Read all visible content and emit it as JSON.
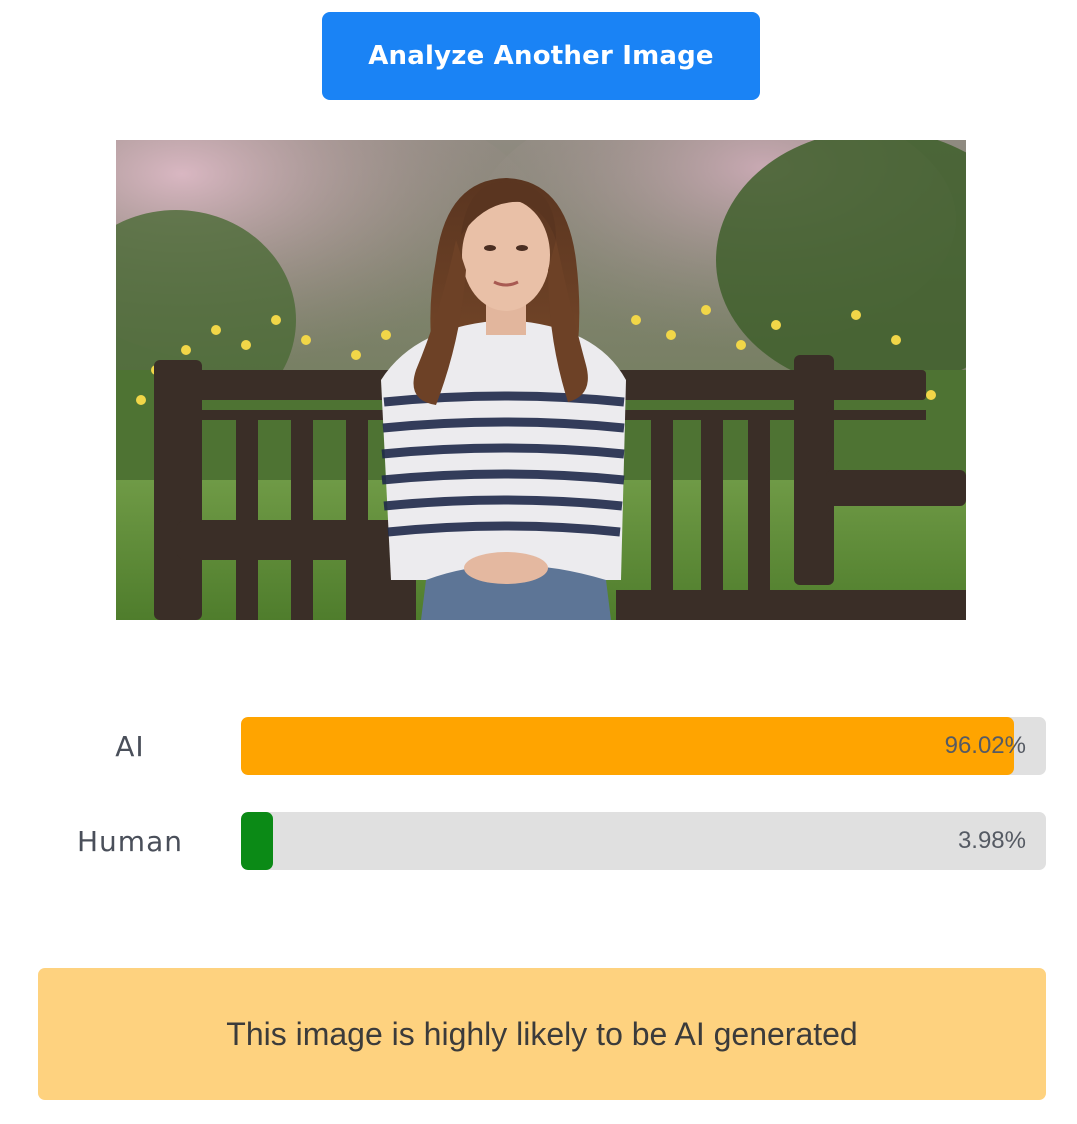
{
  "actions": {
    "analyze_label": "Analyze Another Image"
  },
  "results": [
    {
      "label": "AI",
      "value_text": "96.02%",
      "percent": 96.02,
      "color": "#ffa400"
    },
    {
      "label": "Human",
      "value_text": "3.98%",
      "percent": 3.98,
      "color": "#0b8a16"
    }
  ],
  "verdict": {
    "text": "This image is highly likely to be AI generated",
    "background": "#fed27f"
  },
  "colors": {
    "button": "#1a83f5",
    "track": "#e0e0e0"
  }
}
